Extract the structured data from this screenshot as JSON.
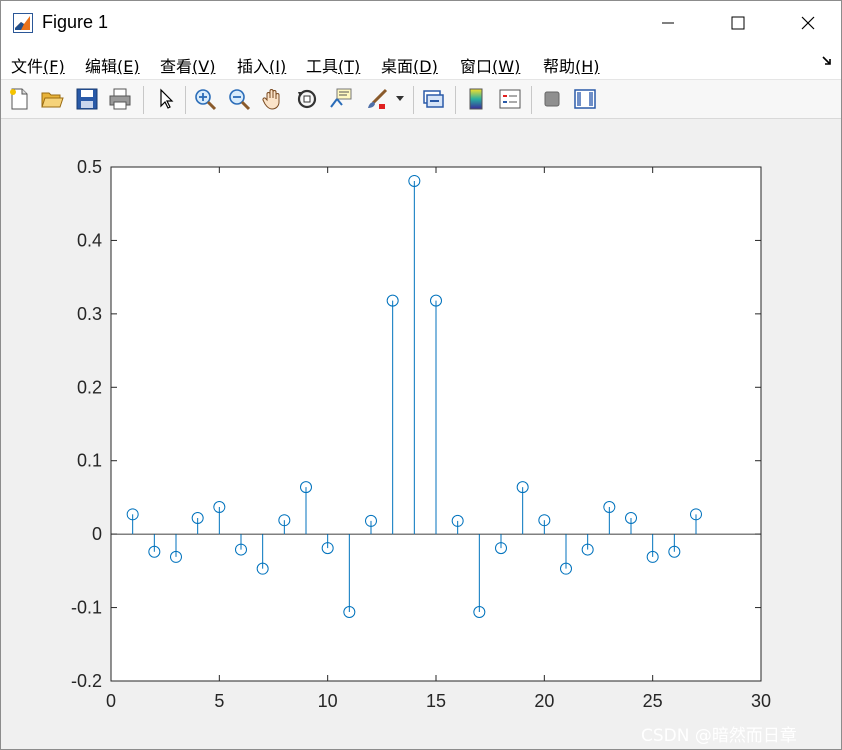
{
  "window": {
    "title": "Figure 1",
    "minimize_label": "—",
    "maximize_label": "☐",
    "close_label": "✕"
  },
  "menu": {
    "items": [
      {
        "label": "文件",
        "key": "(F)"
      },
      {
        "label": "编辑",
        "key": "(E)"
      },
      {
        "label": "查看",
        "key": "(V)"
      },
      {
        "label": "插入",
        "key": "(I)"
      },
      {
        "label": "工具",
        "key": "(T)"
      },
      {
        "label": "桌面",
        "key": "(D)"
      },
      {
        "label": "窗口",
        "key": "(W)"
      },
      {
        "label": "帮助",
        "key": "(H)"
      }
    ],
    "overflow_icon": "dock-arrow-icon"
  },
  "toolbar": {
    "buttons": [
      "new-figure-icon",
      "open-file-icon",
      "save-icon",
      "print-icon",
      "pointer-icon",
      "zoom-in-icon",
      "zoom-out-icon",
      "pan-icon",
      "rotate-3d-icon",
      "data-cursor-icon",
      "brush-icon",
      "link-plot-icon",
      "colorbar-icon",
      "legend-icon",
      "hide-plot-tools-icon",
      "show-plot-tools-icon"
    ]
  },
  "colors": {
    "stem": "#0072BD",
    "axis": "#262626",
    "background": "#f0f0f0"
  },
  "chart_data": {
    "type": "stem",
    "title": "",
    "xlabel": "",
    "ylabel": "",
    "xlim": [
      0,
      30
    ],
    "ylim": [
      -0.2,
      0.5
    ],
    "xticks": [
      0,
      5,
      10,
      15,
      20,
      25,
      30
    ],
    "yticks": [
      -0.2,
      -0.1,
      0,
      0.1,
      0.2,
      0.3,
      0.4,
      0.5
    ],
    "xtick_labels": [
      "0",
      "5",
      "10",
      "15",
      "20",
      "25",
      "30"
    ],
    "ytick_labels": [
      "-0.2",
      "-0.1",
      "0",
      "0.1",
      "0.2",
      "0.3",
      "0.4",
      "0.5"
    ],
    "grid": false,
    "baseline": 0,
    "x": [
      1,
      2,
      3,
      4,
      5,
      6,
      7,
      8,
      9,
      10,
      11,
      12,
      13,
      14,
      15,
      16,
      17,
      18,
      19,
      20,
      21,
      22,
      23,
      24,
      25,
      26,
      27
    ],
    "y": [
      0.027,
      -0.024,
      -0.031,
      0.022,
      0.037,
      -0.021,
      -0.047,
      0.019,
      0.064,
      -0.019,
      -0.106,
      0.018,
      0.318,
      0.481,
      0.318,
      0.018,
      -0.106,
      -0.019,
      0.064,
      0.019,
      -0.047,
      -0.021,
      0.037,
      0.022,
      -0.031,
      -0.024,
      0.027
    ]
  },
  "watermark": "CSDN @暗然而日章"
}
